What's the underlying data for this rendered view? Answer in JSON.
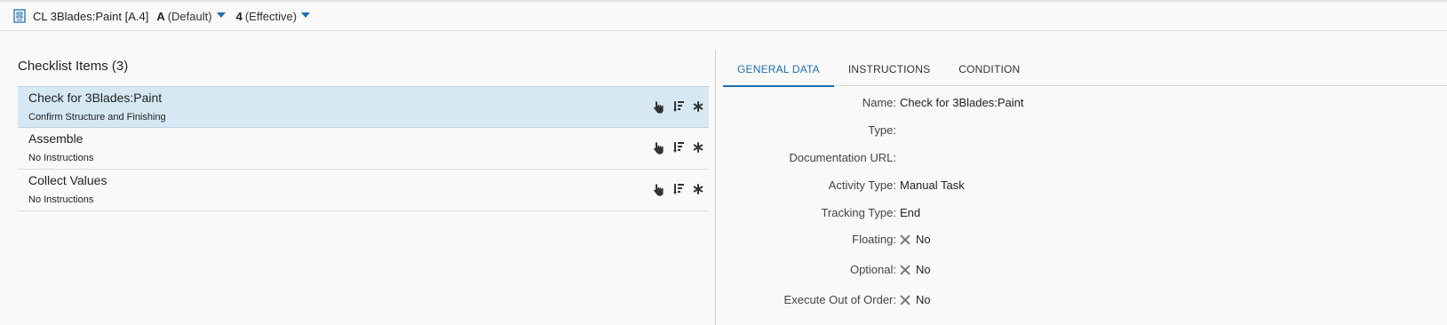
{
  "header": {
    "title": "CL 3Blades:Paint [A.4]",
    "revision_letter": "A",
    "revision_label": "(Default)",
    "iteration_number": "4",
    "iteration_label": "(Effective)"
  },
  "checklist": {
    "title": "Checklist Items (3)",
    "items": [
      {
        "name": "Check for 3Blades:Paint",
        "sub": "Confirm Structure and Finishing",
        "selected": true
      },
      {
        "name": "Assemble",
        "sub": "No Instructions",
        "selected": false
      },
      {
        "name": "Collect Values",
        "sub": "No Instructions",
        "selected": false
      }
    ],
    "action_icons": [
      "hand-pointer-icon",
      "sort-icon",
      "asterisk-icon"
    ]
  },
  "tabs": [
    {
      "label": "GENERAL DATA",
      "active": true
    },
    {
      "label": "INSTRUCTIONS",
      "active": false
    },
    {
      "label": "CONDITION",
      "active": false
    }
  ],
  "properties": {
    "name_label": "Name:",
    "name_value": "Check for 3Blades:Paint",
    "type_label": "Type:",
    "type_value": "",
    "doc_url_label": "Documentation URL:",
    "doc_url_value": "",
    "activity_type_label": "Activity Type:",
    "activity_type_value": "Manual Task",
    "tracking_type_label": "Tracking Type:",
    "tracking_type_value": "End",
    "floating_label": "Floating:",
    "floating_value": "No",
    "optional_label": "Optional:",
    "optional_value": "No",
    "execute_out_of_order_label": "Execute Out of Order:",
    "execute_out_of_order_value": "No"
  },
  "colors": {
    "accent": "#1f6fb2",
    "selected_row": "#d6e8f4"
  }
}
